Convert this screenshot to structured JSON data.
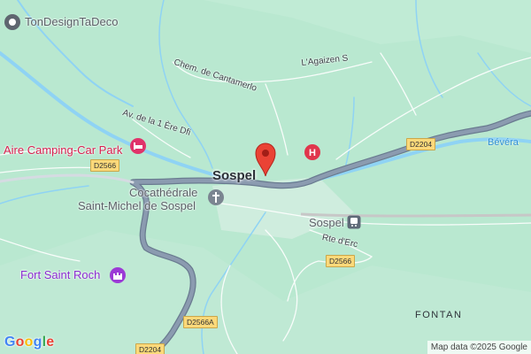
{
  "map": {
    "places": {
      "tondesign": "TonDesignTaDeco",
      "aire_camping": "Aire Camping-Car Park",
      "cocathedrale_line1": "Cocathédrale",
      "cocathedrale_line2": "Saint-Michel de Sospel",
      "fort_saint_roch": "Fort Saint Roch",
      "sospel_station": "Sospel"
    },
    "town_label": "Sospel",
    "streets": {
      "chem_cantamerlo": "Chem. de Cantamerlo",
      "agaizen": "L'Agaizen S",
      "av_1ere_dfi": "Av. de la 1 Ère Dfi",
      "rte_erc": "Rte d'Erc"
    },
    "river": "Bévéra",
    "area": "FONTAN",
    "road_shields": {
      "d2566_west": "D2566",
      "d2204_east": "D2204",
      "d2566_east": "D2566",
      "d2566a": "D2566A",
      "d2204_south": "D2204"
    },
    "google_logo": "Google",
    "attribution": "Map data ©2025 Google",
    "colors": {
      "land": "#b9e8d0",
      "water": "#8fd3f4",
      "main_road": "#7d8ea3",
      "poi_red": "#d8204f",
      "poi_purple": "#8a2bd0",
      "pin": "#ea4335"
    },
    "icons": {
      "tondesign": "place-marker-icon",
      "aire_camping": "lodging-icon",
      "cocathedrale": "church-icon",
      "fort": "landmark-icon",
      "station": "train-station-icon",
      "hospital": "hospital-icon",
      "pin": "location-pin-icon"
    }
  }
}
